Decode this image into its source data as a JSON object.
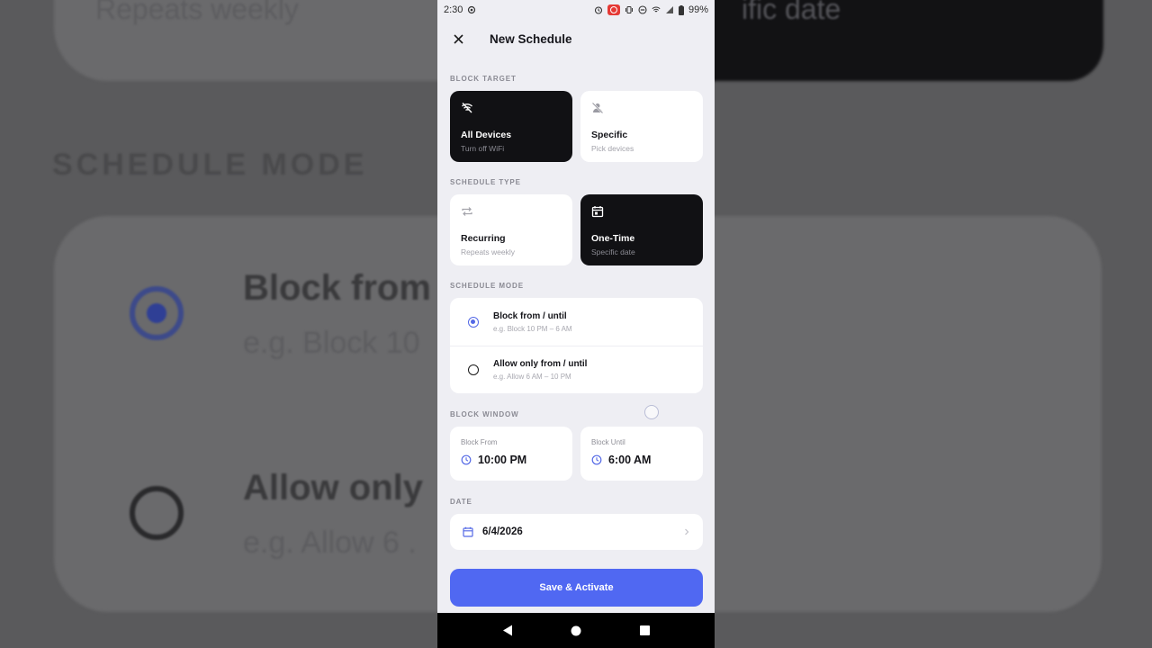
{
  "status_bar": {
    "time": "2:30",
    "battery": "99%"
  },
  "app_bar": {
    "title": "New Schedule"
  },
  "block_target": {
    "label": "BLOCK TARGET",
    "options": [
      {
        "title": "All Devices",
        "subtitle": "Turn off WiFi",
        "selected": true,
        "icon": "wifi-off-icon"
      },
      {
        "title": "Specific",
        "subtitle": "Pick devices",
        "selected": false,
        "icon": "person-off-icon"
      }
    ]
  },
  "schedule_type": {
    "label": "SCHEDULE TYPE",
    "options": [
      {
        "title": "Recurring",
        "subtitle": "Repeats weekly",
        "selected": false,
        "icon": "repeat-icon"
      },
      {
        "title": "One-Time",
        "subtitle": "Specific date",
        "selected": true,
        "icon": "calendar-icon"
      }
    ]
  },
  "schedule_mode": {
    "label": "SCHEDULE MODE",
    "options": [
      {
        "title": "Block from / until",
        "subtitle": "e.g. Block 10 PM – 6 AM",
        "selected": true
      },
      {
        "title": "Allow only from / until",
        "subtitle": "e.g. Allow 6 AM – 10 PM",
        "selected": false
      }
    ]
  },
  "block_window": {
    "label": "BLOCK WINDOW",
    "from": {
      "label": "Block From",
      "value": "10:00 PM"
    },
    "until": {
      "label": "Block Until",
      "value": "6:00 AM"
    }
  },
  "date": {
    "label": "DATE",
    "value": "6/4/2026"
  },
  "save_button": {
    "label": "Save & Activate"
  },
  "background_zoom": {
    "heading": "SCHEDULE MODE",
    "top_left": "Repeats weekly",
    "top_right": "ific date",
    "row1_title": "Block from",
    "row1_sub": "e.g. Block 10",
    "row2_title": "Allow only",
    "row2_sub": "e.g. Allow 6 ."
  },
  "colors": {
    "accent": "#5068f2",
    "dark_card": "#111114",
    "page_bg": "#eeeef3"
  }
}
